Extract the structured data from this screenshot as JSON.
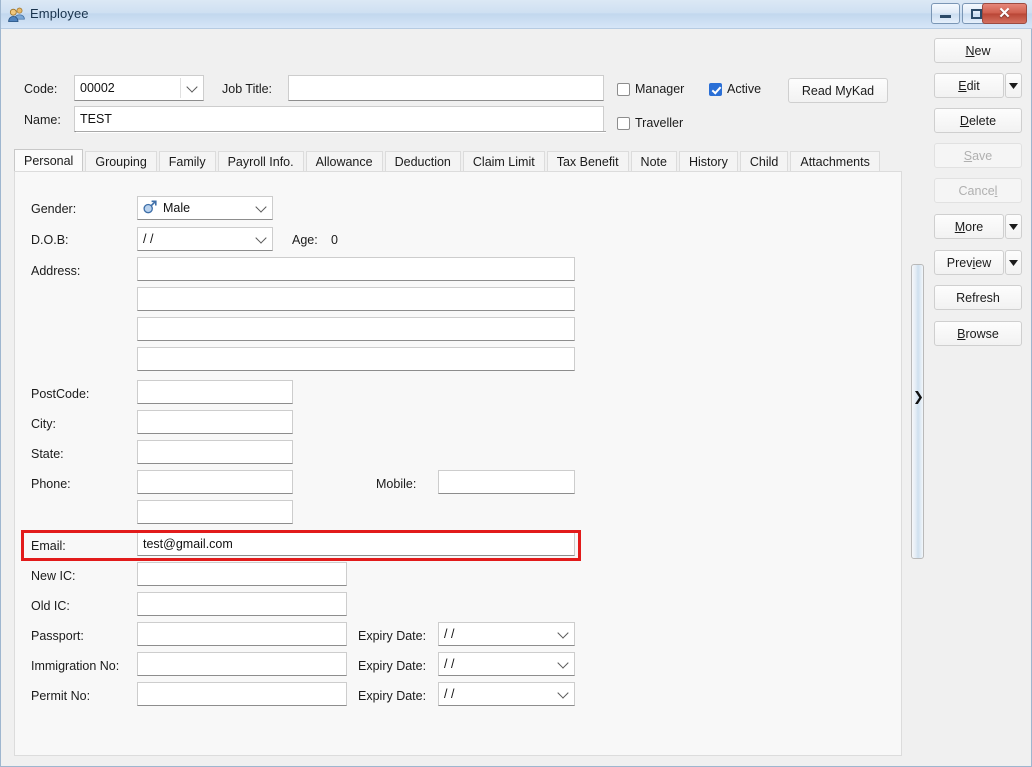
{
  "window": {
    "title": "Employee",
    "title_icon": "employees-icon",
    "controls": {
      "minimize": "minimize-icon",
      "maximize": "maximize-icon",
      "close": "close-icon",
      "close_glyph": "✕"
    }
  },
  "header": {
    "code_label": "Code:",
    "code_value": "00002",
    "job_title_label": "Job Title:",
    "job_title_value": "",
    "name_label": "Name:",
    "name_value": "TEST",
    "manager_label": "Manager",
    "manager_checked": false,
    "active_label": "Active",
    "active_checked": true,
    "traveller_label": "Traveller",
    "traveller_checked": false,
    "read_mykad_label": "Read MyKad"
  },
  "action_buttons": [
    {
      "label": "New",
      "accel": "N",
      "enabled": true,
      "split": false
    },
    {
      "label": "Edit",
      "accel": "E",
      "enabled": true,
      "split": true
    },
    {
      "label": "Delete",
      "accel": "D",
      "enabled": true,
      "split": false
    },
    {
      "label": "Save",
      "accel": "S",
      "enabled": false,
      "split": false
    },
    {
      "label": "Cancel",
      "accel": "l",
      "enabled": false,
      "split": false
    },
    {
      "label": "More",
      "accel": "M",
      "enabled": true,
      "split": true
    },
    {
      "label": "Preview",
      "accel": "i",
      "enabled": true,
      "split": true
    },
    {
      "label": "Refresh",
      "accel": "",
      "enabled": true,
      "split": false
    },
    {
      "label": "Browse",
      "accel": "B",
      "enabled": true,
      "split": false
    }
  ],
  "tabs": [
    {
      "label": "Personal",
      "active": true
    },
    {
      "label": "Grouping",
      "active": false
    },
    {
      "label": "Family",
      "active": false
    },
    {
      "label": "Payroll Info.",
      "active": false
    },
    {
      "label": "Allowance",
      "active": false
    },
    {
      "label": "Deduction",
      "active": false
    },
    {
      "label": "Claim Limit",
      "active": false
    },
    {
      "label": "Tax Benefit",
      "active": false
    },
    {
      "label": "Note",
      "active": false
    },
    {
      "label": "History",
      "active": false
    },
    {
      "label": "Child",
      "active": false
    },
    {
      "label": "Attachments",
      "active": false
    }
  ],
  "personal": {
    "gender_label": "Gender:",
    "gender_value": "Male",
    "gender_icon": "male-gender-icon",
    "dob_label": "D.O.B:",
    "dob_value": "/ /",
    "age_label": "Age:",
    "age_value": "0",
    "address_label": "Address:",
    "address_line1": "",
    "address_line2": "",
    "address_line3": "",
    "address_line4": "",
    "postcode_label": "PostCode:",
    "postcode_value": "",
    "city_label": "City:",
    "city_value": "",
    "state_label": "State:",
    "state_value": "",
    "phone_label": "Phone:",
    "phone_value": "",
    "phone2_value": "",
    "mobile_label": "Mobile:",
    "mobile_value": "",
    "email_label": "Email:",
    "email_value": "test@gmail.com",
    "new_ic_label": "New IC:",
    "new_ic_value": "",
    "old_ic_label": "Old IC:",
    "old_ic_value": "",
    "passport_label": "Passport:",
    "passport_value": "",
    "passport_expiry_label": "Expiry Date:",
    "passport_expiry_value": "/ /",
    "immigration_label": "Immigration No:",
    "immigration_value": "",
    "immigration_expiry_label": "Expiry Date:",
    "immigration_expiry_value": "/ /",
    "permit_label": "Permit No:",
    "permit_value": "",
    "permit_expiry_label": "Expiry Date:",
    "permit_expiry_value": "/ /"
  },
  "splitter": {
    "arrow": "❯"
  },
  "colors": {
    "highlight_box": "#e21b1b",
    "accent_checkbox": "#2a6fd6",
    "titlebar": "#cfe0f2"
  }
}
